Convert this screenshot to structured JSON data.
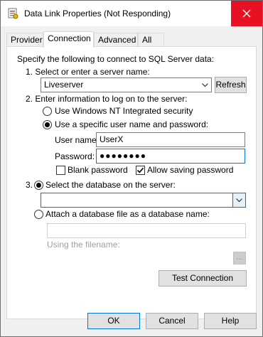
{
  "window": {
    "title": "Data Link Properties (Not Responding)"
  },
  "tabs": [
    {
      "label": "Provider"
    },
    {
      "label": "Connection"
    },
    {
      "label": "Advanced"
    },
    {
      "label": "All"
    }
  ],
  "connection": {
    "intro": "Specify the following to connect to SQL Server data:",
    "step1_label": "1. Select or enter a server name:",
    "server_value": "Liveserver",
    "refresh_label": "Refresh",
    "step2_label": "2. Enter information to log on to the server:",
    "nt_security_label": "Use Windows NT Integrated security",
    "specific_user_label": "Use a specific user name and password:",
    "username_label": "User name:",
    "username_value": "UserX",
    "password_label": "Password:",
    "password_value": "●●●●●●●●",
    "blank_password_label": "Blank password",
    "allow_saving_label": "Allow saving password",
    "step3_number": "3.",
    "select_db_label": "Select the database on the server:",
    "database_value": "",
    "attach_db_label": "Attach a database file as a database name:",
    "attach_db_value": "",
    "using_filename_label": "Using the filename:",
    "browse_label": "...",
    "test_connection_label": "Test Connection"
  },
  "footer": {
    "ok_label": "OK",
    "cancel_label": "Cancel",
    "help_label": "Help"
  },
  "state": {
    "auth_mode": "specific_user",
    "db_mode": "select",
    "blank_password_checked": false,
    "allow_saving_checked": true
  },
  "colors": {
    "close_button": "#e81123",
    "focus_border": "#0078d7"
  }
}
